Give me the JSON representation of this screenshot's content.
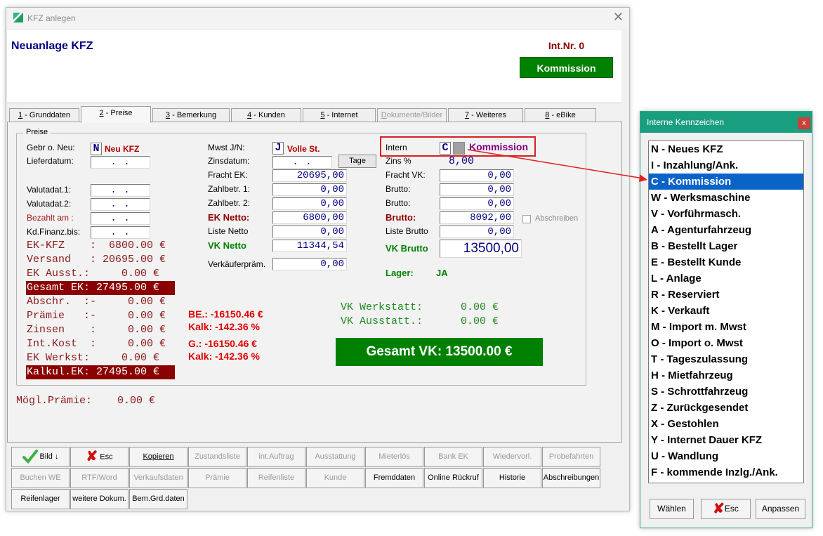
{
  "window": {
    "title": "KFZ anlegen",
    "header_title": "Neuanlage KFZ",
    "int_nr": "Int.Nr. 0",
    "badge": "Kommission"
  },
  "tabs": [
    {
      "num": "1",
      "label": " - Grunddaten",
      "active": false,
      "disabled": false
    },
    {
      "num": "2",
      "label": " - Preise",
      "active": true,
      "disabled": false
    },
    {
      "num": "3",
      "label": " - Bemerkung",
      "active": false,
      "disabled": false
    },
    {
      "num": "4",
      "label": " - Kunden",
      "active": false,
      "disabled": false
    },
    {
      "num": "5",
      "label": " - Internet",
      "active": false,
      "disabled": false
    },
    {
      "num": "D",
      "label": "okumente/Bilder",
      "active": false,
      "disabled": true
    },
    {
      "num": "7",
      "label": " - Weiteres",
      "active": false,
      "disabled": false
    },
    {
      "num": "8",
      "label": " - eBike",
      "active": false,
      "disabled": false
    }
  ],
  "preise": {
    "group_label": "Preise",
    "left": {
      "gebr_label": "Gebr o. Neu:",
      "gebr_value": "N",
      "gebr_text": "Neu KFZ",
      "lieferdatum_label": "Lieferdatum:",
      "lieferdatum_value": " .  . ",
      "valuta1_label": "Valutadat.1:",
      "valuta1_value": " .  . ",
      "valuta2_label": "Valutadat.2:",
      "valuta2_value": " .  . ",
      "bezahlt_label": "Bezahlt am :",
      "bezahlt_value": " .  . ",
      "kdfinanz_label": "Kd.Finanz.bis:",
      "kdfinanz_value": " .  . "
    },
    "summary": [
      {
        "text": "EK-KFZ    :  6800.00 €",
        "highlight": false
      },
      {
        "text": "Versand   : 20695.00 €",
        "highlight": false
      },
      {
        "text": "EK Ausst.:     0.00 €",
        "highlight": false
      },
      {
        "text": "Gesamt EK: 27495.00 €",
        "highlight": true
      },
      {
        "text": "Abschr.  :-     0.00 €",
        "highlight": false
      },
      {
        "text": "Prämie   :-     0.00 €",
        "highlight": false
      },
      {
        "text": "Zinsen    :     0.00 €",
        "highlight": false
      },
      {
        "text": "Int.Kost  :     0.00 €",
        "highlight": false
      },
      {
        "text": "EK Werkst:     0.00 €",
        "highlight": false
      },
      {
        "text": "Kalkul.EK: 27495.00 €",
        "highlight": true
      }
    ],
    "moegl_praemie": "Mögl.Prämie:    0.00 €",
    "middle": {
      "mwst_label": "Mwst J/N:",
      "mwst_value": "J",
      "mwst_text": "Volle St.",
      "zinsdatum_label": "Zinsdatum:",
      "zinsdatum_value": " .  . ",
      "tage_button": "Tage",
      "fracht_ek_label": "Fracht EK:",
      "fracht_ek_value": "20695,00",
      "zahlbetr1_label": "Zahlbetr. 1:",
      "zahlbetr1_value": "0,00",
      "zahlbetr2_label": "Zahlbetr. 2:",
      "zahlbetr2_value": "0,00",
      "ek_netto_label": "EK Netto:",
      "ek_netto_value": "6800,00",
      "liste_netto_label": "Liste Netto",
      "liste_netto_value": "0,00",
      "vk_netto_label": "VK Netto",
      "vk_netto_value": "11344,54",
      "verkaeufer_label": "Verkäuferpräm.",
      "verkaeufer_value": "0,00"
    },
    "right": {
      "intern_label": "Intern",
      "intern_value": "C",
      "intern_text": "Kommission",
      "zins_label": "Zins %",
      "zins_value": "8,00",
      "fracht_vk_label": "Fracht VK:",
      "fracht_vk_value": "0,00",
      "brutto1_label": "Brutto:",
      "brutto1_value": "0,00",
      "brutto2_label": "Brutto:",
      "brutto2_value": "0,00",
      "brutto_label": "Brutto:",
      "brutto_value": "8092,00",
      "abschreiben_label": "Abschreiben",
      "liste_brutto_label": "Liste Brutto",
      "liste_brutto_value": "0,00",
      "vk_brutto_label": "VK Brutto",
      "vk_brutto_value": "13500,00",
      "lager_label": "Lager:",
      "lager_value": "JA"
    },
    "calc": {
      "be": "BE.: -16150.46 €",
      "kalk1": "Kalk: -142.36 %",
      "g": "G.: -16150.46 €",
      "kalk2": "Kalk: -142.36 %"
    },
    "vk_werkstatt": "VK Werkstatt:      0.00 €",
    "vk_ausstatt": "VK Ausstatt.:      0.00 €",
    "gesamt_vk": "Gesamt VK:   13500.00 €"
  },
  "buttons_row1": [
    {
      "label": "Bild",
      "disabled": false
    },
    {
      "label": "Esc",
      "disabled": false
    },
    {
      "label": "Kopieren",
      "disabled": false
    },
    {
      "label": "Zustandsliste",
      "disabled": true
    },
    {
      "label": "int.Auftrag",
      "disabled": true
    },
    {
      "label": "Ausstattung",
      "disabled": true
    },
    {
      "label": "Mieterlös",
      "disabled": true
    },
    {
      "label": "Bank EK",
      "disabled": true
    },
    {
      "label": "Wiedervorl.",
      "disabled": true
    },
    {
      "label": "Probefahrten",
      "disabled": true
    }
  ],
  "buttons_row2": [
    {
      "label": "Buchen WE",
      "disabled": true
    },
    {
      "label": "RTF/Word",
      "disabled": true
    },
    {
      "label": "Verkaufsdaten",
      "disabled": true
    },
    {
      "label": "Prämie",
      "disabled": true
    },
    {
      "label": "Reifenliste",
      "disabled": true
    },
    {
      "label": "Kunde",
      "disabled": true
    },
    {
      "label": "Fremddaten",
      "disabled": false
    },
    {
      "label": "Online Rückruf",
      "disabled": false
    },
    {
      "label": "Historie",
      "disabled": false
    },
    {
      "label": "Abschreibungen",
      "disabled": false
    }
  ],
  "buttons_row3": [
    {
      "label": "Reifenlager",
      "disabled": false
    },
    {
      "label": "weitere Dokum.",
      "disabled": false
    },
    {
      "label": "Bem.Grd.daten",
      "disabled": false
    }
  ],
  "popup": {
    "title": "Interne Kennzeichen",
    "close": "x",
    "items": [
      "N - Neues KFZ",
      "I - Inzahlung/Ank.",
      "C - Kommission",
      "W - Werksmaschine",
      "V - Vorführmasch.",
      "A - Agenturfahrzeug",
      "B - Bestellt Lager",
      "E - Bestellt Kunde",
      "L - Anlage",
      "R - Reserviert",
      "K - Verkauft",
      "M - Import m. Mwst",
      "O - Import o. Mwst",
      "T - Tageszulassung",
      "H - Mietfahrzeug",
      "S - Schrottfahrzeug",
      "Z - Zurückgesendet",
      "X - Gestohlen",
      "Y - Internet Dauer KFZ",
      "U - Wandlung",
      "F - kommende Inzlg./Ank."
    ],
    "selected_index": 2,
    "btn_waehlen": "Wählen",
    "btn_esc": "Esc",
    "btn_anpassen": "Anpassen"
  },
  "colors": {
    "accent_green": "#008000",
    "dark_red": "#8b0000",
    "popup_title": "#1a9e80",
    "selection": "#0a64c8"
  }
}
